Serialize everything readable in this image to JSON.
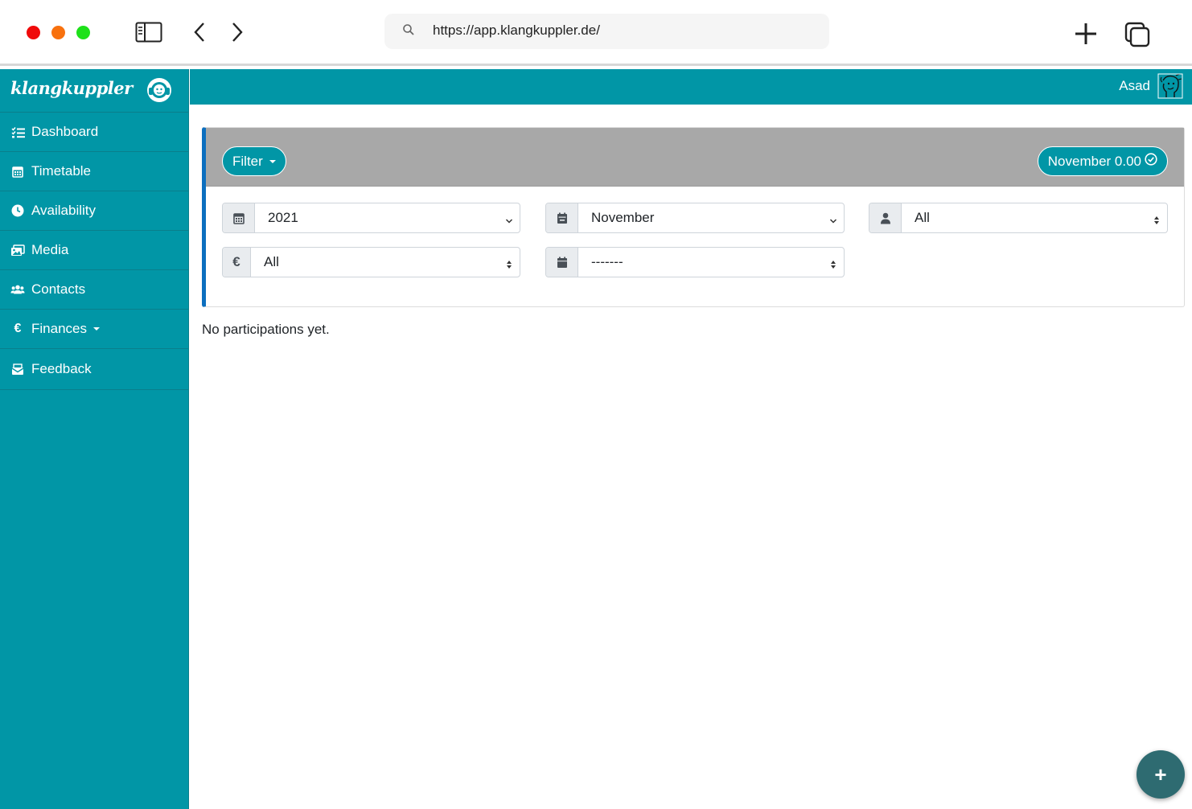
{
  "browser": {
    "url": "https://app.klangkuppler.de/"
  },
  "sidebar": {
    "brand": "klangkuppler",
    "items": [
      {
        "label": "Dashboard",
        "icon": "tasks-icon"
      },
      {
        "label": "Timetable",
        "icon": "calendar-icon"
      },
      {
        "label": "Availability",
        "icon": "clock-icon"
      },
      {
        "label": "Media",
        "icon": "images-icon"
      },
      {
        "label": "Contacts",
        "icon": "users-icon"
      },
      {
        "label": "Finances",
        "icon": "euro-icon"
      },
      {
        "label": "Feedback",
        "icon": "mail-bulk-icon"
      }
    ]
  },
  "topbar": {
    "user_name": "Asad"
  },
  "filters": {
    "filter_label": "Filter",
    "month_badge": "November 0.00",
    "year_value": "2021",
    "month_value": "November",
    "person_value": "All",
    "currency_symbol": "€",
    "currency_value": "All",
    "date_value": "-------"
  },
  "main": {
    "empty_message": "No participations yet."
  },
  "fab": {
    "label": "+"
  },
  "colors": {
    "accent": "#0196a6",
    "card_border": "#0c6fbf",
    "header_grey": "#a8a8a8",
    "fab": "#2e6b71"
  }
}
